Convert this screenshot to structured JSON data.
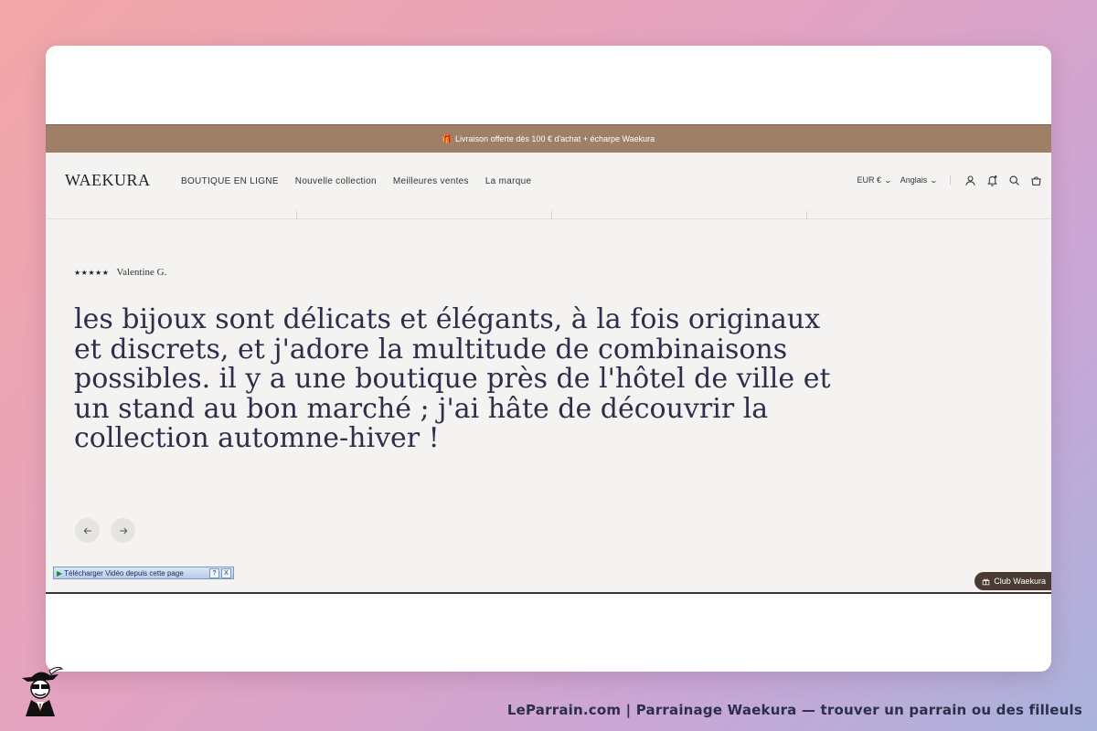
{
  "announcement": {
    "text": "Livraison offerte dès 100 € d'achat + écharpe Waekura"
  },
  "header": {
    "logo": "WAEKURA",
    "nav": [
      {
        "label": "BOUTIQUE EN LIGNE"
      },
      {
        "label": "Nouvelle collection"
      },
      {
        "label": "Meilleures ventes"
      },
      {
        "label": "La marque"
      }
    ],
    "currency": "EUR €",
    "language": "Anglais",
    "icons": [
      "account-icon",
      "notification-bell-icon",
      "search-icon",
      "cart-icon"
    ]
  },
  "review": {
    "stars": "★★★★★",
    "rating": 5,
    "author": "Valentine G.",
    "text": "les bijoux sont délicats et élégants, à la fois originaux et discrets, et j'adore la multitude de combinaisons possibles. il y a une boutique près de l'hôtel de ville et un stand au bon marché ; j'ai hâte de découvrir la collection automne-hiver !"
  },
  "download_bar": {
    "label": "Télécharger Vidéo depuis cette page",
    "help": "?",
    "close": "X"
  },
  "club_button": {
    "label": "Club Waekura"
  },
  "caption": "LeParrain.com | Parrainage Waekura — trouver un parrain ou des filleuls",
  "colors": {
    "announcement_bg": "#a07f67",
    "page_bg": "#f4f3f1",
    "quote_text": "#2b2f4a",
    "club_bg": "#4a3a31"
  }
}
